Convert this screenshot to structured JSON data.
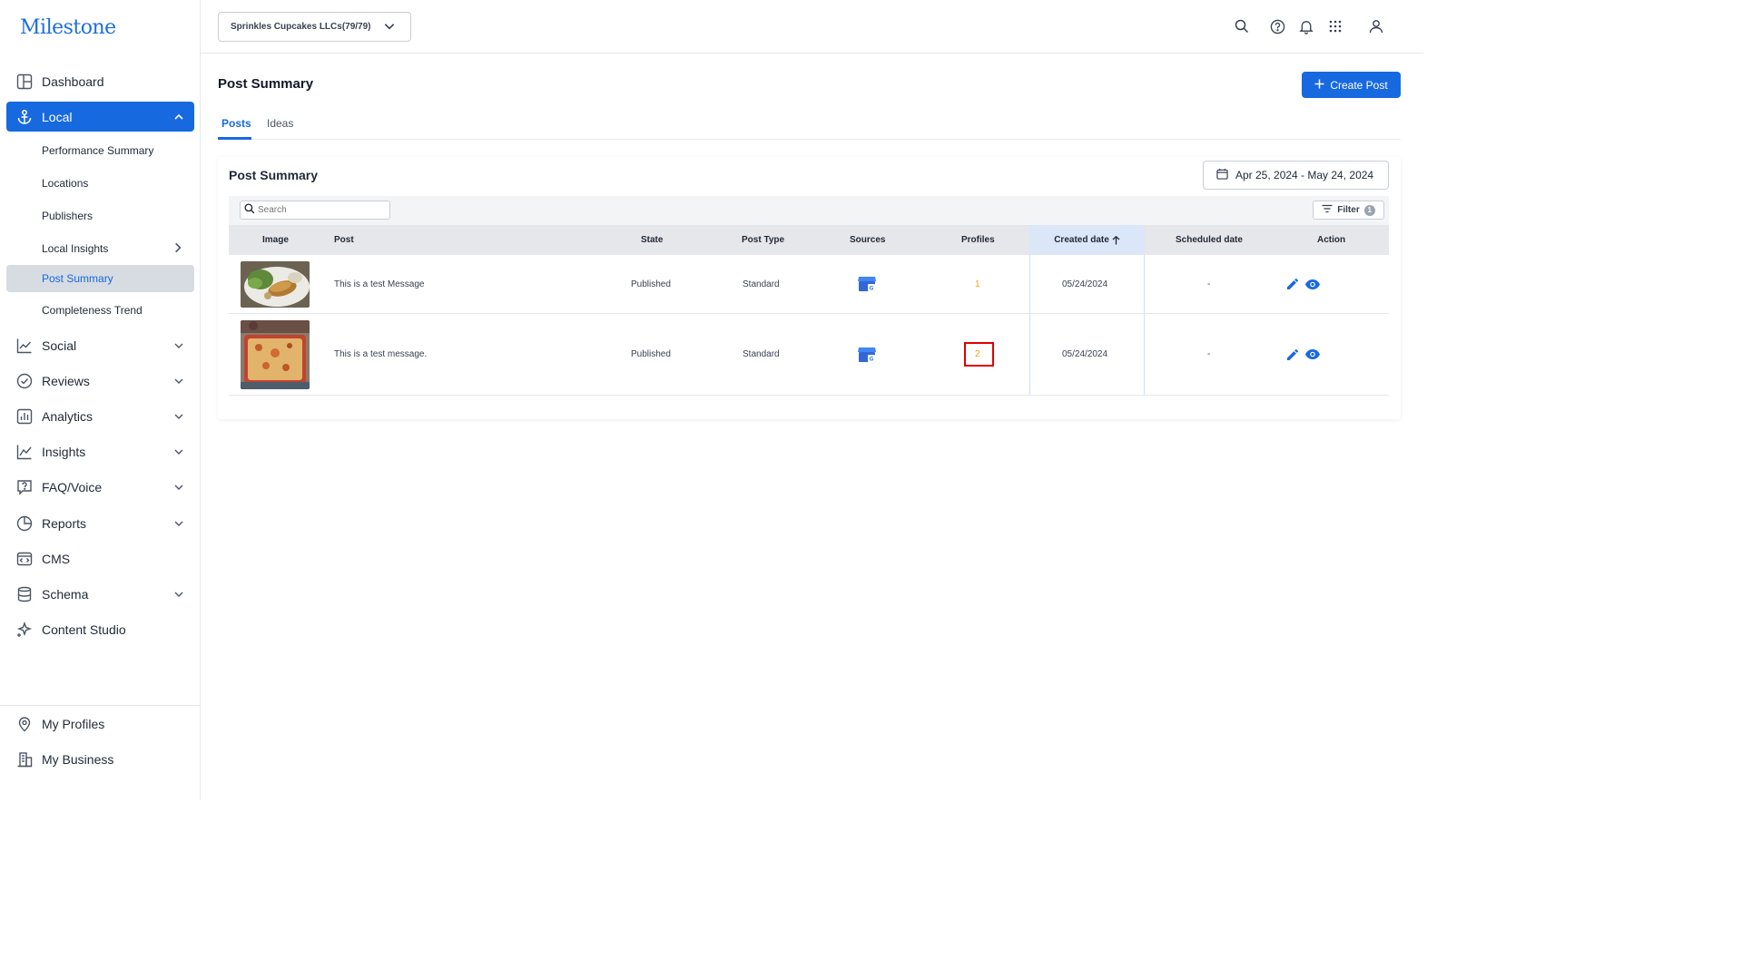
{
  "brand": {
    "logo_text": "Milestone",
    "accent": "#1769e0"
  },
  "sidebar": {
    "items": [
      {
        "label": "Dashboard",
        "icon": "dashboard-icon"
      },
      {
        "label": "Local",
        "icon": "anchor-icon",
        "active": true
      },
      {
        "label": "Social",
        "icon": "social-chart-icon"
      },
      {
        "label": "Reviews",
        "icon": "check-badge-icon"
      },
      {
        "label": "Analytics",
        "icon": "bar-chart-icon"
      },
      {
        "label": "Insights",
        "icon": "line-chart-icon"
      },
      {
        "label": "FAQ/Voice",
        "icon": "question-bubble-icon"
      },
      {
        "label": "Reports",
        "icon": "pie-chart-icon"
      },
      {
        "label": "CMS",
        "icon": "code-window-icon"
      },
      {
        "label": "Schema",
        "icon": "database-icon"
      },
      {
        "label": "Content Studio",
        "icon": "sparkle-icon"
      }
    ],
    "local_sub_items": [
      {
        "label": "Performance Summary"
      },
      {
        "label": "Locations"
      },
      {
        "label": "Publishers"
      },
      {
        "label": "Local Insights"
      },
      {
        "label": "Post Summary",
        "selected": true
      },
      {
        "label": "Completeness Trend"
      }
    ],
    "footer_items": [
      {
        "label": "My Profiles",
        "icon": "location-pin-icon"
      },
      {
        "label": "My Business",
        "icon": "building-icon"
      }
    ]
  },
  "topbar": {
    "account_select": "Sprinkles Cupcakes LLCs(79/79)"
  },
  "main": {
    "title": "Post Summary",
    "create_button": "Create Post",
    "tabs": [
      {
        "label": "Posts",
        "active": true
      },
      {
        "label": "Ideas",
        "active": false
      }
    ],
    "card": {
      "title": "Post Summary",
      "date_range": "Apr 25, 2024 - May 24, 2024",
      "search_placeholder": "Search",
      "filter_label": "Filter",
      "filter_count": "1",
      "columns": [
        "Image",
        "Post",
        "State",
        "Post Type",
        "Sources",
        "Profiles",
        "Created date",
        "Scheduled date",
        "Action"
      ],
      "rows": [
        {
          "post": "This is a test Message",
          "state": "Published",
          "post_type": "Standard",
          "source": "google-business-icon",
          "profiles": "1",
          "created": "05/24/2024",
          "scheduled": "-"
        },
        {
          "post": "This is a test message.",
          "state": "Published",
          "post_type": "Standard",
          "source": "google-business-icon",
          "profiles": "2",
          "created": "05/24/2024",
          "scheduled": "-"
        }
      ]
    }
  }
}
